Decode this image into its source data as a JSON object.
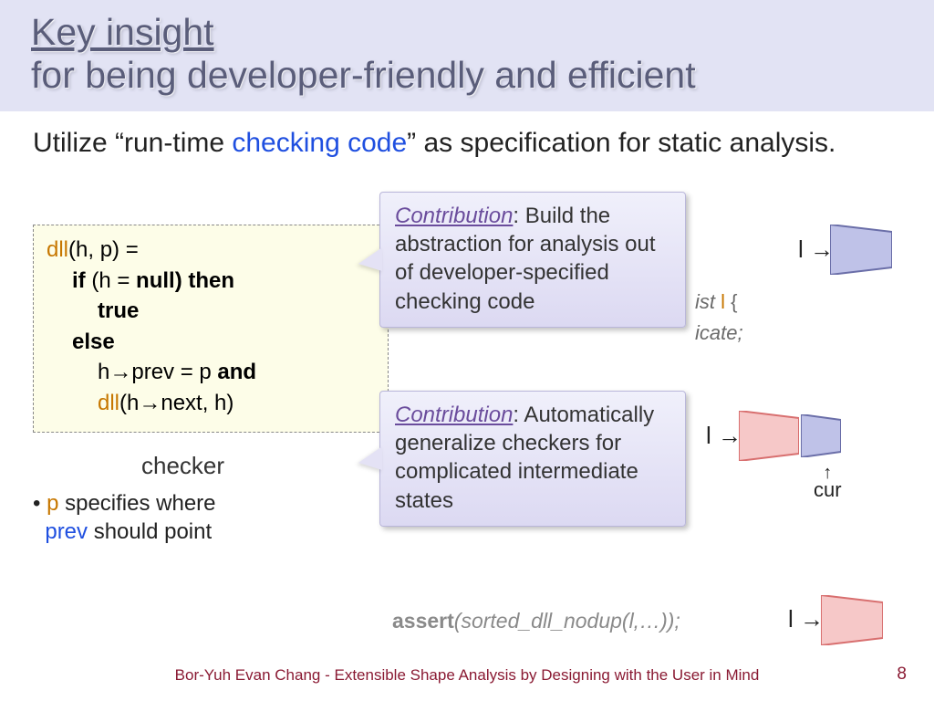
{
  "header": {
    "line1": "Key insight",
    "line2": "for being developer-friendly and efficient"
  },
  "body": {
    "pre": "Utilize “run-time ",
    "blue": "checking code",
    "post": "” as specification for static analysis."
  },
  "checker": {
    "fn": "dll",
    "sig_rest": "(h, p) =",
    "if_kw": "if",
    "cond": " (h = ",
    "null_kw": "null",
    "then_kw": ") then",
    "true_kw": "true",
    "else_kw": "else",
    "body_pre": "h→prev = p  ",
    "and_kw": "and",
    "rec_rest": "(h→next, h)",
    "label": "checker"
  },
  "bullet": {
    "dot": "• ",
    "p": "p",
    "mid": " specifies where ",
    "prev": "prev",
    "end": " should point"
  },
  "callout1": {
    "head": "Contribution",
    "text": ": Build the abstraction for analysis out of developer-specified checking code"
  },
  "callout2": {
    "head": "Contribution",
    "text": ": Automatically generalize checkers for complicated intermediate states"
  },
  "code_frags": {
    "ist": "ist ",
    "l_var": "l",
    "brace": " {",
    "icate": "icate;"
  },
  "assert_line": {
    "kw": "assert",
    "body": "(sorted_dll_nodup(l,…));"
  },
  "labels": {
    "l_arrow": "l →",
    "cur": "cur",
    "up_arrow": "↑"
  },
  "colors": {
    "trap_blue_fill": "#bfc2e8",
    "trap_blue_stroke": "#6a6ea8",
    "trap_pink_fill": "#f6c8c8",
    "trap_pink_stroke": "#d86f6f"
  },
  "footer": {
    "text": "Bor-Yuh Evan Chang - Extensible Shape Analysis by Designing with the User in Mind",
    "page": "8"
  }
}
